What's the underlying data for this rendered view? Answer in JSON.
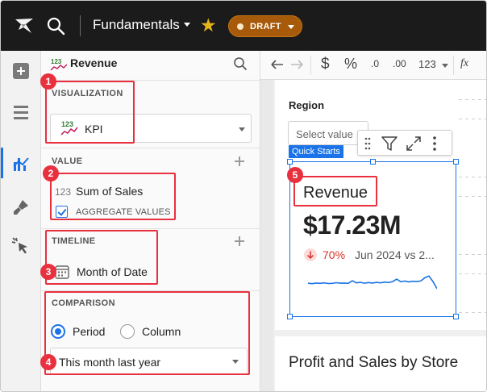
{
  "topbar": {
    "workbook_title": "Fundamentals",
    "status_badge": "DRAFT",
    "icons": [
      "sigma-logo-icon",
      "search-icon",
      "chevron-down-icon",
      "star-icon"
    ]
  },
  "left_rail": {
    "items": [
      {
        "name": "add-element",
        "icon": "plus-icon"
      },
      {
        "name": "layers",
        "icon": "layers-icon"
      },
      {
        "name": "properties",
        "icon": "chart-properties-icon",
        "active": true
      },
      {
        "name": "format",
        "icon": "paint-brush-icon"
      },
      {
        "name": "actions",
        "icon": "cursor-click-icon"
      }
    ]
  },
  "panel": {
    "title": "Revenue",
    "title_icon": "kpi-icon",
    "sections": {
      "visualization": {
        "heading": "VISUALIZATION",
        "value": "KPI"
      },
      "value": {
        "heading": "VALUE",
        "prefix": "123",
        "column": "Sum of Sales",
        "aggregate_label": "AGGREGATE VALUES",
        "aggregate_checked": true
      },
      "timeline": {
        "heading": "TIMELINE",
        "column": "Month of Date"
      },
      "comparison": {
        "heading": "COMPARISON",
        "options": [
          "Period",
          "Column"
        ],
        "selected": "Period",
        "period": "This month last year"
      }
    }
  },
  "toolbar": {
    "items": [
      "undo-icon",
      "redo-icon",
      "currency-icon",
      "percent-icon",
      "decrease-decimals-icon",
      "increase-decimals-icon",
      "number-format-icon",
      "formula-icon"
    ],
    "number_format_label": "123",
    "decrease_decimals_label": ".0",
    "increase_decimals_label": ".00",
    "formula_label": "fx"
  },
  "canvas": {
    "control": {
      "label": "Region",
      "placeholder": "Select value",
      "tag": "Quick Starts"
    },
    "kpi": {
      "title": "Revenue",
      "value": "$17.23M",
      "change": "70%",
      "change_direction": "down",
      "period_text": "Jun 2024 vs 2...",
      "sparkline": [
        0.45,
        0.42,
        0.46,
        0.44,
        0.47,
        0.43,
        0.44,
        0.48,
        0.45,
        0.46,
        0.44,
        0.6,
        0.47,
        0.5,
        0.45,
        0.49,
        0.46,
        0.5,
        0.47,
        0.52,
        0.49,
        0.55,
        0.7,
        0.54,
        0.58,
        0.53,
        0.57,
        0.55,
        0.59,
        0.8,
        0.9,
        0.55,
        0.1
      ]
    },
    "next_card_title": "Profit and Sales by Store"
  },
  "callouts": [
    "1",
    "2",
    "3",
    "4",
    "5"
  ],
  "colors": {
    "accent": "#1a73e8",
    "callout": "#e8303e",
    "draft": "#a65a0a",
    "star": "#e5b41b",
    "negative": "#d93025"
  }
}
